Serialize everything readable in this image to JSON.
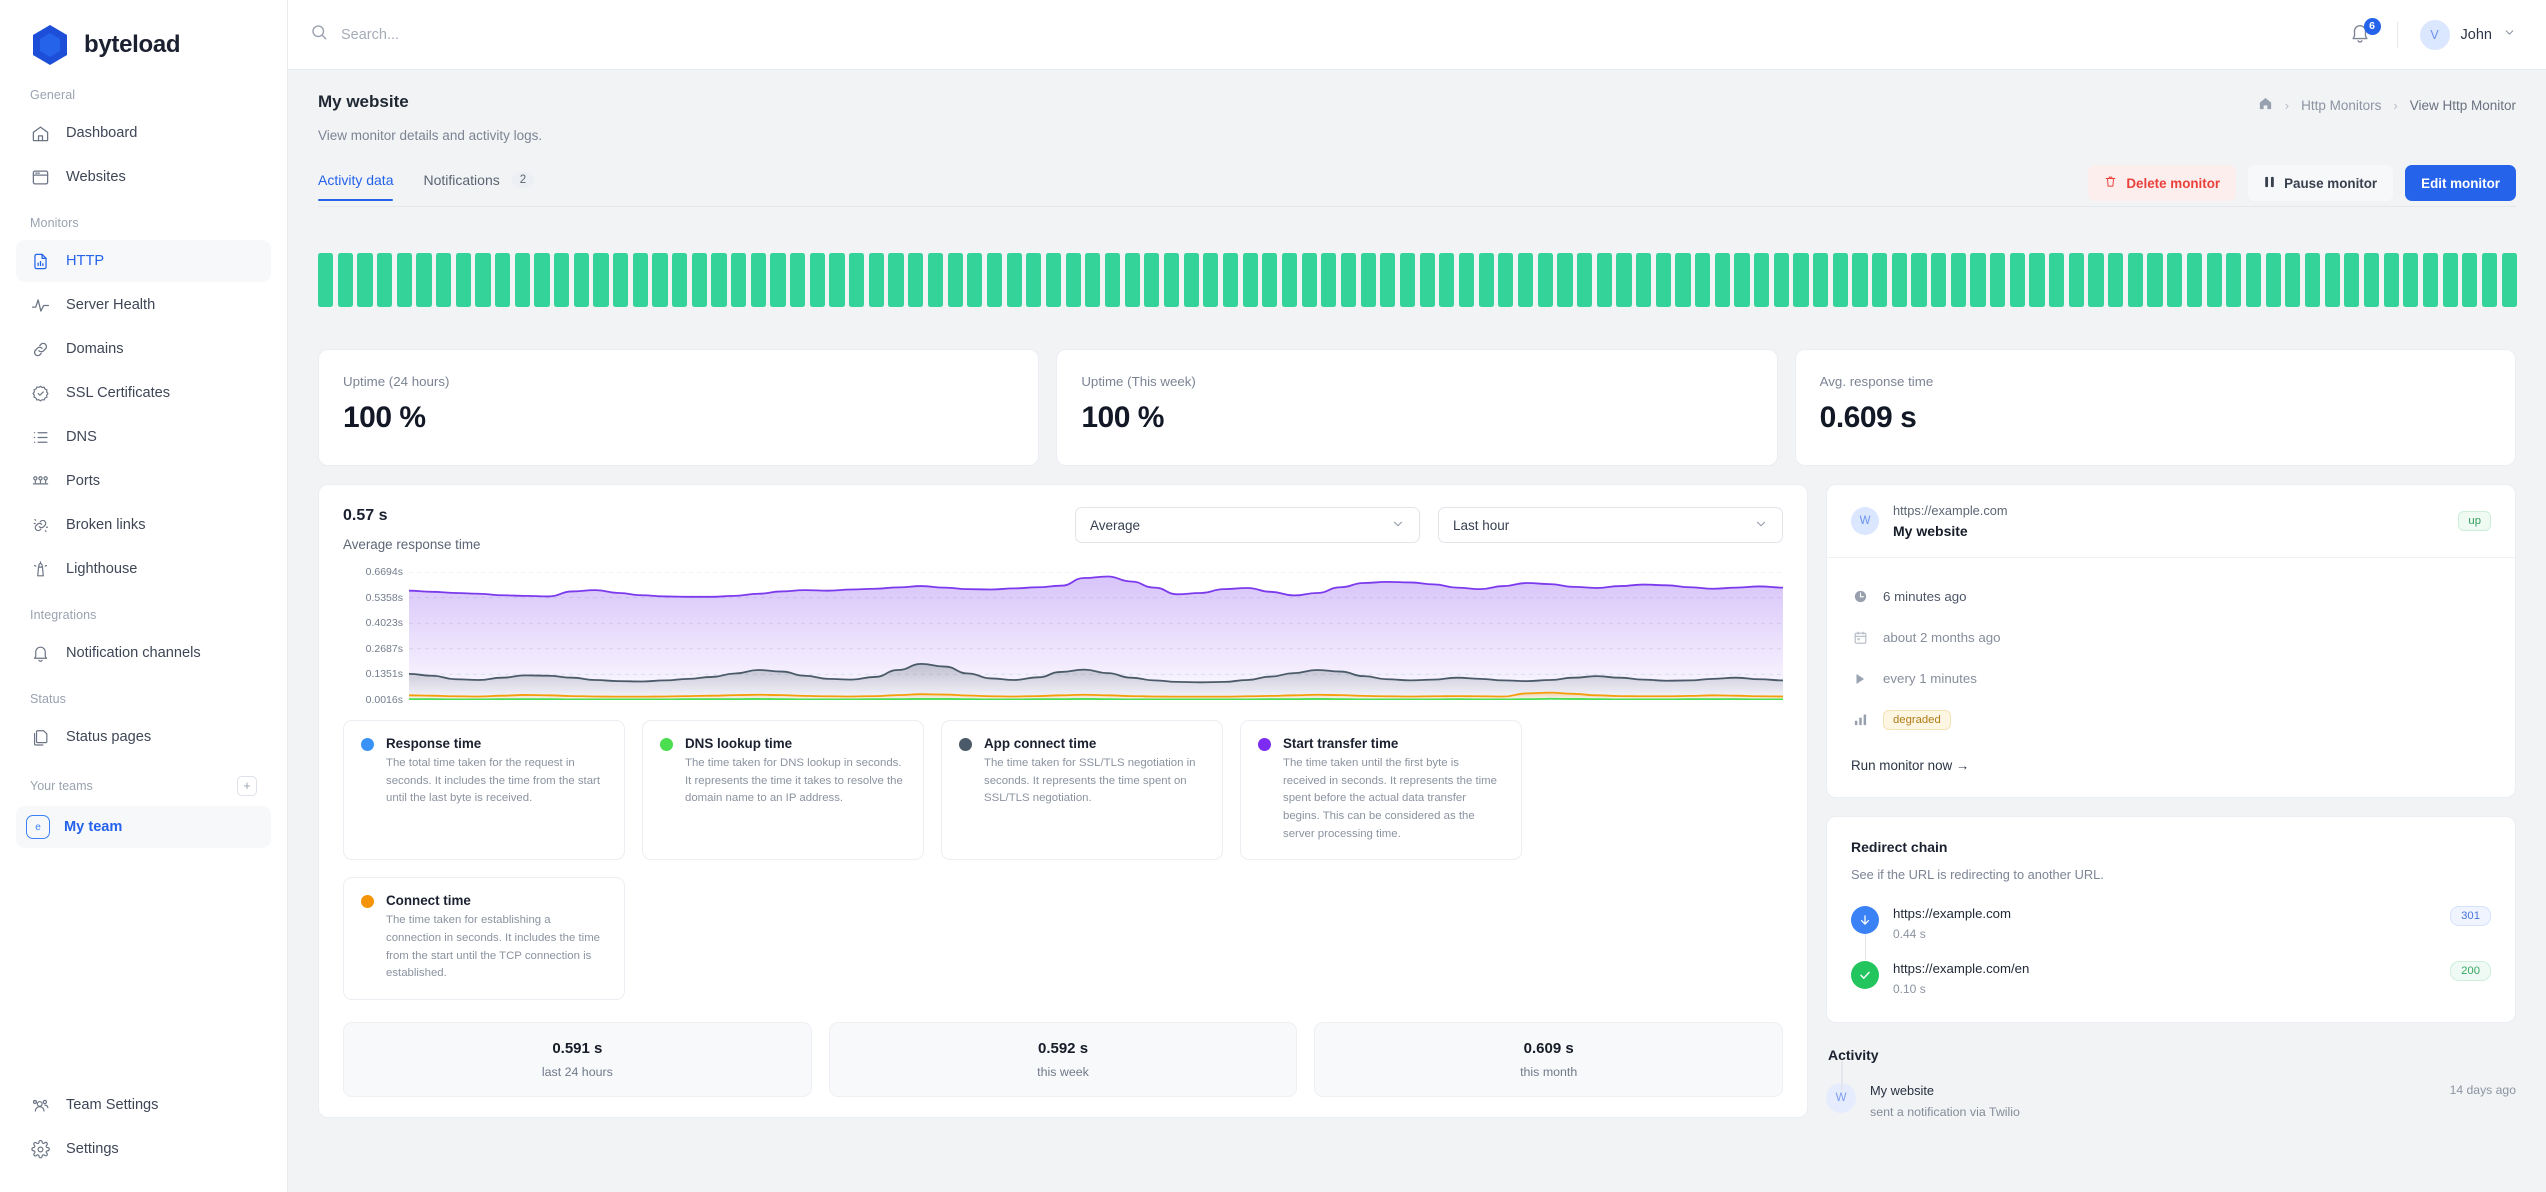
{
  "brand": {
    "name": "byteload"
  },
  "sidebar": {
    "sections": [
      {
        "label": "General",
        "items": [
          {
            "label": "Dashboard",
            "icon": "home-icon",
            "active": false
          },
          {
            "label": "Websites",
            "icon": "window-icon",
            "active": false
          }
        ]
      },
      {
        "label": "Monitors",
        "items": [
          {
            "label": "HTTP",
            "icon": "document-chart-icon",
            "active": true
          },
          {
            "label": "Server Health",
            "icon": "pulse-icon",
            "active": false
          },
          {
            "label": "Domains",
            "icon": "link-icon",
            "active": false
          },
          {
            "label": "SSL Certificates",
            "icon": "badge-check-icon",
            "active": false
          },
          {
            "label": "DNS",
            "icon": "list-icon",
            "active": false
          },
          {
            "label": "Ports",
            "icon": "ports-icon",
            "active": false
          },
          {
            "label": "Broken links",
            "icon": "broken-link-icon",
            "active": false
          },
          {
            "label": "Lighthouse",
            "icon": "lighthouse-icon",
            "active": false
          }
        ]
      },
      {
        "label": "Integrations",
        "items": [
          {
            "label": "Notification channels",
            "icon": "bell-icon",
            "active": false
          }
        ]
      },
      {
        "label": "Status",
        "items": [
          {
            "label": "Status pages",
            "icon": "copy-page-icon",
            "active": false
          }
        ]
      }
    ],
    "teams": {
      "label": "Your teams",
      "add_label": "+",
      "current": {
        "name": "My team",
        "initial": "e"
      }
    },
    "bottom_items": [
      {
        "label": "Team Settings",
        "icon": "users-icon"
      },
      {
        "label": "Settings",
        "icon": "gear-icon"
      }
    ]
  },
  "topbar": {
    "search_placeholder": "Search...",
    "search_value": "",
    "notifications_count": "6",
    "user": {
      "name": "John",
      "initial": "V"
    }
  },
  "page": {
    "title": "My website",
    "subtitle": "View monitor details and activity logs.",
    "breadcrumb": [
      {
        "label": "home-icon",
        "type": "icon"
      },
      {
        "label": "Http Monitors",
        "type": "link"
      },
      {
        "label": "View Http Monitor",
        "type": "current"
      }
    ],
    "tabs": [
      {
        "label": "Activity data",
        "badge": "",
        "active": true
      },
      {
        "label": "Notifications",
        "badge": "2",
        "active": false
      }
    ],
    "actions": {
      "delete_label": "Delete monitor",
      "pause_label": "Pause monitor",
      "edit_label": "Edit monitor"
    }
  },
  "uptime_strip": {
    "bars": 112,
    "color": "#34d399"
  },
  "stats": [
    {
      "label": "Uptime (24 hours)",
      "value": "100 %"
    },
    {
      "label": "Uptime (This week)",
      "value": "100 %"
    },
    {
      "label": "Avg. response time",
      "value": "0.609 s"
    }
  ],
  "chart_panel": {
    "headline_value": "0.57 s",
    "headline_caption": "Average response time",
    "aggregation_select": {
      "value": "Average"
    },
    "range_select": {
      "value": "Last hour"
    }
  },
  "chart_data": {
    "type": "area",
    "title": "Average response time",
    "xlabel": "",
    "ylabel": "seconds",
    "ylim": [
      0.0016,
      0.6694
    ],
    "grid": true,
    "legend_position": "below-cards",
    "ytick_labels": [
      "0.6694s",
      "0.5358s",
      "0.4023s",
      "0.2687s",
      "0.1351s",
      "0.0016s"
    ],
    "ytick_values": [
      0.6694,
      0.5358,
      0.4023,
      0.2687,
      0.1351,
      0.0016
    ],
    "series": [
      {
        "name": "Start transfer time",
        "color": "#7c3aed",
        "values": [
          0.572,
          0.566,
          0.56,
          0.556,
          0.548,
          0.545,
          0.542,
          0.568,
          0.575,
          0.56,
          0.548,
          0.542,
          0.54,
          0.54,
          0.545,
          0.556,
          0.568,
          0.575,
          0.572,
          0.578,
          0.582,
          0.589,
          0.596,
          0.588,
          0.58,
          0.578,
          0.584,
          0.59,
          0.598,
          0.638,
          0.646,
          0.62,
          0.588,
          0.553,
          0.56,
          0.58,
          0.586,
          0.566,
          0.547,
          0.56,
          0.59,
          0.612,
          0.618,
          0.615,
          0.605,
          0.588,
          0.58,
          0.596,
          0.612,
          0.606,
          0.592,
          0.586,
          0.596,
          0.604,
          0.6,
          0.59,
          0.582,
          0.588,
          0.594,
          0.588
        ]
      },
      {
        "name": "App connect time",
        "color": "#4b5a68",
        "values": [
          0.138,
          0.128,
          0.11,
          0.106,
          0.118,
          0.13,
          0.128,
          0.118,
          0.106,
          0.1,
          0.098,
          0.104,
          0.112,
          0.122,
          0.14,
          0.158,
          0.15,
          0.128,
          0.112,
          0.108,
          0.122,
          0.158,
          0.19,
          0.176,
          0.14,
          0.114,
          0.106,
          0.12,
          0.148,
          0.16,
          0.142,
          0.118,
          0.104,
          0.096,
          0.094,
          0.096,
          0.106,
          0.124,
          0.142,
          0.158,
          0.15,
          0.126,
          0.11,
          0.104,
          0.108,
          0.118,
          0.112,
          0.104,
          0.1,
          0.106,
          0.118,
          0.126,
          0.118,
          0.108,
          0.102,
          0.104,
          0.112,
          0.118,
          0.11,
          0.104
        ]
      },
      {
        "name": "Connect time",
        "color": "#f59e0b",
        "values": [
          0.026,
          0.024,
          0.021,
          0.02,
          0.024,
          0.028,
          0.026,
          0.022,
          0.02,
          0.019,
          0.019,
          0.02,
          0.022,
          0.024,
          0.027,
          0.029,
          0.027,
          0.023,
          0.021,
          0.02,
          0.022,
          0.027,
          0.032,
          0.03,
          0.025,
          0.021,
          0.02,
          0.022,
          0.026,
          0.029,
          0.026,
          0.022,
          0.02,
          0.019,
          0.019,
          0.019,
          0.021,
          0.023,
          0.026,
          0.029,
          0.027,
          0.023,
          0.021,
          0.02,
          0.021,
          0.022,
          0.021,
          0.02,
          0.036,
          0.04,
          0.034,
          0.026,
          0.022,
          0.021,
          0.021,
          0.023,
          0.026,
          0.024,
          0.021,
          0.02
        ]
      },
      {
        "name": "DNS lookup time",
        "color": "#4ade50",
        "values": [
          0.006,
          0.006,
          0.005,
          0.005,
          0.006,
          0.006,
          0.006,
          0.005,
          0.005,
          0.005,
          0.005,
          0.005,
          0.006,
          0.006,
          0.006,
          0.007,
          0.006,
          0.005,
          0.005,
          0.005,
          0.006,
          0.006,
          0.007,
          0.007,
          0.006,
          0.005,
          0.005,
          0.006,
          0.006,
          0.007,
          0.006,
          0.005,
          0.005,
          0.005,
          0.005,
          0.005,
          0.005,
          0.006,
          0.006,
          0.007,
          0.006,
          0.005,
          0.005,
          0.005,
          0.005,
          0.006,
          0.005,
          0.005,
          0.006,
          0.008,
          0.007,
          0.006,
          0.005,
          0.005,
          0.005,
          0.006,
          0.006,
          0.006,
          0.005,
          0.005
        ]
      }
    ]
  },
  "legend_cards": [
    {
      "title": "Response time",
      "color": "#3b93f7",
      "desc": "The total time taken for the request in seconds. It includes the time from the start until the last byte is received."
    },
    {
      "title": "DNS lookup time",
      "color": "#4ade50",
      "desc": "The time taken for DNS lookup in seconds. It represents the time it takes to resolve the domain name to an IP address."
    },
    {
      "title": "App connect time",
      "color": "#4b5a68",
      "desc": "The time taken for SSL/TLS negotiation in seconds. It represents the time spent on SSL/TLS negotiation."
    },
    {
      "title": "Start transfer time",
      "color": "#7c2bf0",
      "desc": "The time taken until the first byte is received in seconds. It represents the time spent before the actual data transfer begins. This can be considered as the server processing time."
    },
    {
      "title": "Connect time",
      "color": "#f59408",
      "desc": "The time taken for establishing a connection in seconds. It includes the time from the start until the TCP connection is established."
    }
  ],
  "summary": [
    {
      "value": "0.591 s",
      "label": "last 24 hours"
    },
    {
      "value": "0.592 s",
      "label": "this week"
    },
    {
      "value": "0.609 s",
      "label": "this month"
    }
  ],
  "monitor_panel": {
    "avatar_initial": "W",
    "url": "https://example.com",
    "name": "My website",
    "status_pill": "up",
    "rows": [
      {
        "icon": "clock-icon",
        "text": "6 minutes ago",
        "muted": false
      },
      {
        "icon": "calendar-icon",
        "text": "about 2 months ago",
        "muted": true
      },
      {
        "icon": "play-icon",
        "text": "every 1 minutes",
        "muted": true
      },
      {
        "icon": "bars-icon",
        "text": "degraded",
        "pill": "warn"
      }
    ],
    "run_link": "Run monitor now →"
  },
  "redirect_chain": {
    "title": "Redirect chain",
    "subtitle": "See if the URL is redirecting to another URL.",
    "items": [
      {
        "url": "https://example.com",
        "time": "0.44 s",
        "code": "301",
        "code_type": "301",
        "icon": "arrow-down-icon",
        "dot_color": "#3b82f6"
      },
      {
        "url": "https://example.com/en",
        "time": "0.10 s",
        "code": "200",
        "code_type": "200",
        "icon": "check-icon",
        "dot_color": "#22c55e"
      }
    ]
  },
  "activity": {
    "title": "Activity",
    "items": [
      {
        "avatar_initial": "W",
        "name": "My website",
        "desc": "sent a notification via Twilio",
        "time": "14 days ago"
      }
    ]
  }
}
